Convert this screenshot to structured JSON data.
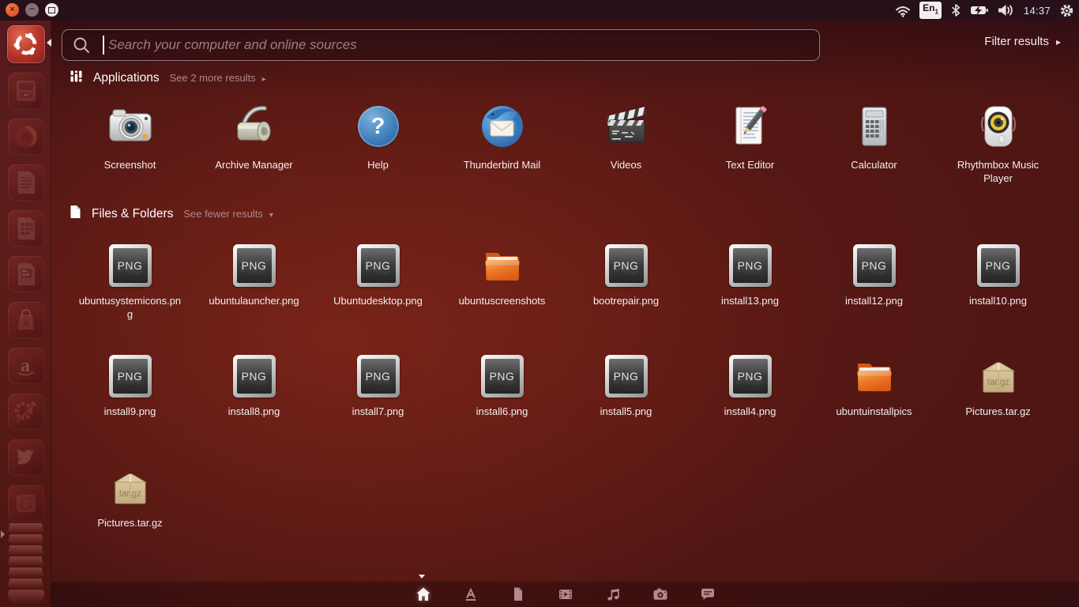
{
  "top_bar": {
    "time": "14:37",
    "keyboard_layout": "En",
    "keyboard_layout_index": "1",
    "tray_icon_names": [
      "wifi-icon",
      "keyboard-layout-indicator",
      "bluetooth-icon",
      "battery-charging-icon",
      "volume-icon",
      "clock",
      "session-gear-icon"
    ]
  },
  "icons": {
    "close_glyph": "×",
    "minimize_glyph": "−",
    "help_glyph": "?",
    "expander_right_arrow": "▸",
    "expander_down_arrow": "▾",
    "filter_arrow": "▸"
  },
  "dash": {
    "search_placeholder": "Search your computer and online sources",
    "filter_label": "Filter results",
    "png_badge": "PNG",
    "targz_badge": "tar.gz",
    "apps": {
      "title": "Applications",
      "expander": "See 2 more results",
      "items": [
        {
          "label": "Screenshot",
          "icon": "camera-app-icon"
        },
        {
          "label": "Archive Manager",
          "icon": "archive-roller-icon"
        },
        {
          "label": "Help",
          "icon": "help-question-icon"
        },
        {
          "label": "Thunderbird Mail",
          "icon": "thunderbird-icon"
        },
        {
          "label": "Videos",
          "icon": "clapperboard-icon"
        },
        {
          "label": "Text Editor",
          "icon": "text-editor-icon"
        },
        {
          "label": "Calculator",
          "icon": "calculator-icon"
        },
        {
          "label": "Rhythmbox Music Player",
          "icon": "speaker-icon"
        }
      ]
    },
    "files": {
      "title": "Files & Folders",
      "expander": "See fewer results",
      "items": [
        {
          "label": "ubuntusystemicons.png",
          "type": "png"
        },
        {
          "label": "ubuntulauncher.png",
          "type": "png"
        },
        {
          "label": "Ubuntudesktop.png",
          "type": "png"
        },
        {
          "label": "ubuntuscreenshots",
          "type": "folder"
        },
        {
          "label": "bootrepair.png",
          "type": "png"
        },
        {
          "label": "install13.png",
          "type": "png"
        },
        {
          "label": "install12.png",
          "type": "png"
        },
        {
          "label": "install10.png",
          "type": "png"
        },
        {
          "label": "install9.png",
          "type": "png"
        },
        {
          "label": "install8.png",
          "type": "png"
        },
        {
          "label": "install7.png",
          "type": "png"
        },
        {
          "label": "install6.png",
          "type": "png"
        },
        {
          "label": "install5.png",
          "type": "png"
        },
        {
          "label": "install4.png",
          "type": "png"
        },
        {
          "label": "ubuntuinstallpics",
          "type": "folder"
        },
        {
          "label": "Pictures.tar.gz",
          "type": "targz"
        },
        {
          "label": "Pictures.tar.gz",
          "type": "targz"
        }
      ]
    },
    "lens_bar": [
      "home-lens",
      "applications-lens",
      "files-lens",
      "videos-lens",
      "music-lens",
      "photos-lens",
      "social-lens"
    ]
  },
  "launcher": {
    "item_names": [
      "ubuntu-dash-button",
      "files-app",
      "firefox",
      "libreoffice-writer",
      "libreoffice-calc",
      "libreoffice-impress",
      "software-center",
      "amazon",
      "system-settings",
      "twitter",
      "sticky-notes",
      "collapsed-items",
      "trash"
    ]
  },
  "colors": {
    "panel": "#27101a",
    "dash_red": "#5e1a14",
    "launcher_red": "#571a19",
    "close_orange": "#e0552a",
    "folder_orange": "#e8731a",
    "muted_text": "#ab8a8f",
    "time_text": "#d9e6f2"
  }
}
